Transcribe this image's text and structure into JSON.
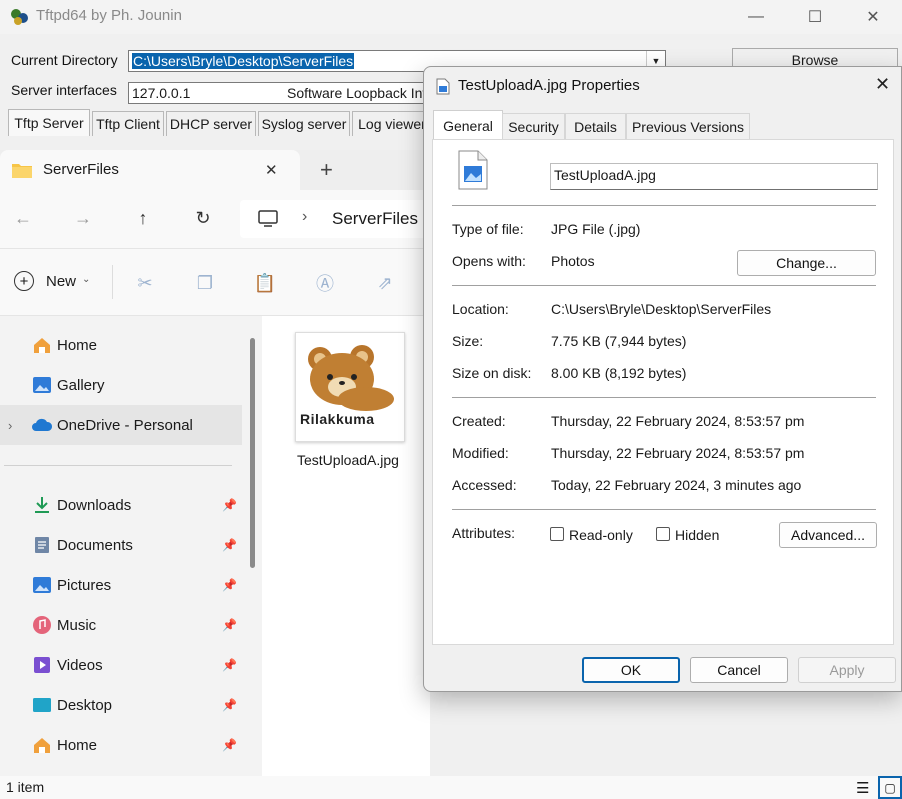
{
  "tftpd": {
    "title": "Tftpd64 by Ph. Jounin",
    "current_directory_label": "Current Directory",
    "current_directory_value": "C:\\Users\\Bryle\\Desktop\\ServerFiles",
    "server_interfaces_label": "Server interfaces",
    "server_interface_ip": "127.0.0.1",
    "server_interface_name": "Software Loopback Int",
    "browse_label": "Browse",
    "tabs": [
      "Tftp Server",
      "Tftp Client",
      "DHCP server",
      "Syslog server",
      "Log viewer"
    ],
    "window_controls": {
      "minimize": "—",
      "maximize": "☐",
      "close": "✕"
    }
  },
  "explorer": {
    "tab_title": "ServerFiles",
    "new_tab_symbol": "+",
    "tab_close_symbol": "✕",
    "breadcrumb": {
      "separator": "›",
      "current": "ServerFiles"
    },
    "new_label": "New",
    "nav_items": [
      {
        "label": "Home",
        "icon": "home-icon"
      },
      {
        "label": "Gallery",
        "icon": "gallery-icon"
      },
      {
        "label": "OneDrive - Personal",
        "icon": "onedrive-icon"
      },
      {
        "label": "Downloads",
        "icon": "downloads-icon"
      },
      {
        "label": "Documents",
        "icon": "documents-icon"
      },
      {
        "label": "Pictures",
        "icon": "pictures-icon"
      },
      {
        "label": "Music",
        "icon": "music-icon"
      },
      {
        "label": "Videos",
        "icon": "videos-icon"
      },
      {
        "label": "Desktop",
        "icon": "desktop-icon"
      },
      {
        "label": "Home",
        "icon": "home-icon"
      }
    ],
    "file": {
      "name": "TestUploadA.jpg",
      "thumbnail_text": "Rilakkuma"
    },
    "status": "1 item"
  },
  "properties": {
    "title": "TestUploadA.jpg Properties",
    "tabs": [
      "General",
      "Security",
      "Details",
      "Previous Versions"
    ],
    "filename": "TestUploadA.jpg",
    "type_label": "Type of file:",
    "type_value": "JPG File (.jpg)",
    "opens_label": "Opens with:",
    "opens_value": "Photos",
    "change_label": "Change...",
    "location_label": "Location:",
    "location_value": "C:\\Users\\Bryle\\Desktop\\ServerFiles",
    "size_label": "Size:",
    "size_value": "7.75 KB (7,944 bytes)",
    "size_disk_label": "Size on disk:",
    "size_disk_value": "8.00 KB (8,192 bytes)",
    "created_label": "Created:",
    "created_value": "Thursday, 22 February 2024, 8:53:57 pm",
    "modified_label": "Modified:",
    "modified_value": "Thursday, 22 February 2024, 8:53:57 pm",
    "accessed_label": "Accessed:",
    "accessed_value": "Today, 22 February 2024, 3 minutes ago",
    "attributes_label": "Attributes:",
    "readonly_label": "Read-only",
    "hidden_label": "Hidden",
    "advanced_label": "Advanced...",
    "ok_label": "OK",
    "cancel_label": "Cancel",
    "apply_label": "Apply"
  },
  "colors": {
    "accent": "#0a64ad",
    "onedrive_row": "#e5e5e5",
    "dialog_bg": "#f0f0f0"
  }
}
